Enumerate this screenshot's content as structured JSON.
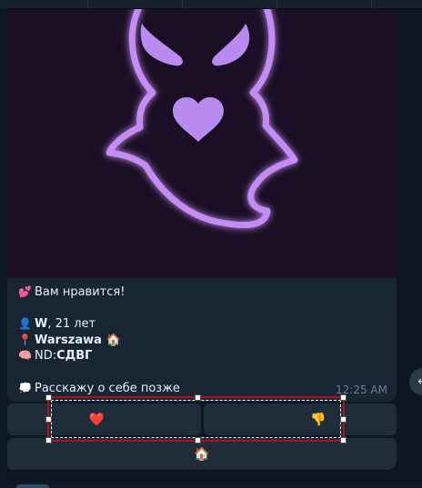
{
  "message": {
    "photo_caption_heart_color": "#b98af0",
    "lines": [
      {
        "emoji": "💕",
        "text": "Вам нравится!"
      },
      {
        "emoji": "👤",
        "name": "W",
        "text": ", 21 лет"
      },
      {
        "emoji": "📍",
        "city": "Warszawa",
        "suffix": "🏠"
      },
      {
        "emoji": "🧠",
        "text": "ND: ",
        "bold": "СДВГ"
      },
      {
        "emoji": "💭",
        "text": "Расскажу о себе позже"
      }
    ],
    "time": "12:25 AM"
  },
  "keyboard": {
    "row1": [
      {
        "label": "❤️"
      },
      {
        "label": "👎"
      }
    ],
    "row2": [
      {
        "label": "🏠"
      }
    ]
  },
  "icons": {
    "scroll_button": "reply-arrow-icon"
  },
  "colors": {
    "selection_border": "#b0101e",
    "ghost_outline": "#c48bf3"
  }
}
